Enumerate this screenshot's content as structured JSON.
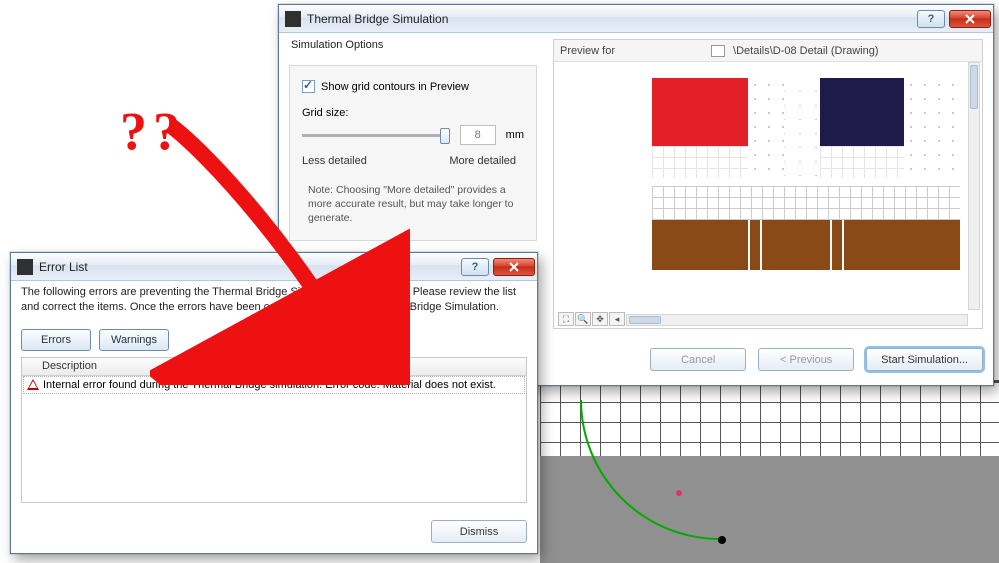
{
  "annotation": {
    "qmarks": "??"
  },
  "thermal": {
    "title": "Thermal Bridge Simulation",
    "options_heading": "Simulation Options",
    "show_grid_label": "Show grid contours in Preview",
    "show_grid_checked": true,
    "grid_size_label": "Grid size:",
    "grid_size_value": "8",
    "grid_size_unit": "mm",
    "less_label": "Less detailed",
    "more_label": "More detailed",
    "note": "Note: Choosing \"More detailed\" provides a more accurate result, but may take longer to generate.",
    "preview_for_label": "Preview for",
    "preview_path": "\\Details\\D-08 Detail (Drawing)",
    "cancel_label": "Cancel",
    "previous_label": "< Previous",
    "start_label": "Start Simulation..."
  },
  "errors": {
    "title": "Error List",
    "intro": "The following errors are preventing the Thermal Bridge Simulation from running. Please review the list and correct the items. Once the errors have been corrected, re-run the Thermal Bridge Simulation.",
    "tab_errors": "Errors",
    "tab_warnings": "Warnings",
    "col_description": "Description",
    "rows": [
      "Internal error found during the Thermal Bridge simulation. Error code: Material does not exist."
    ],
    "dismiss_label": "Dismiss"
  }
}
